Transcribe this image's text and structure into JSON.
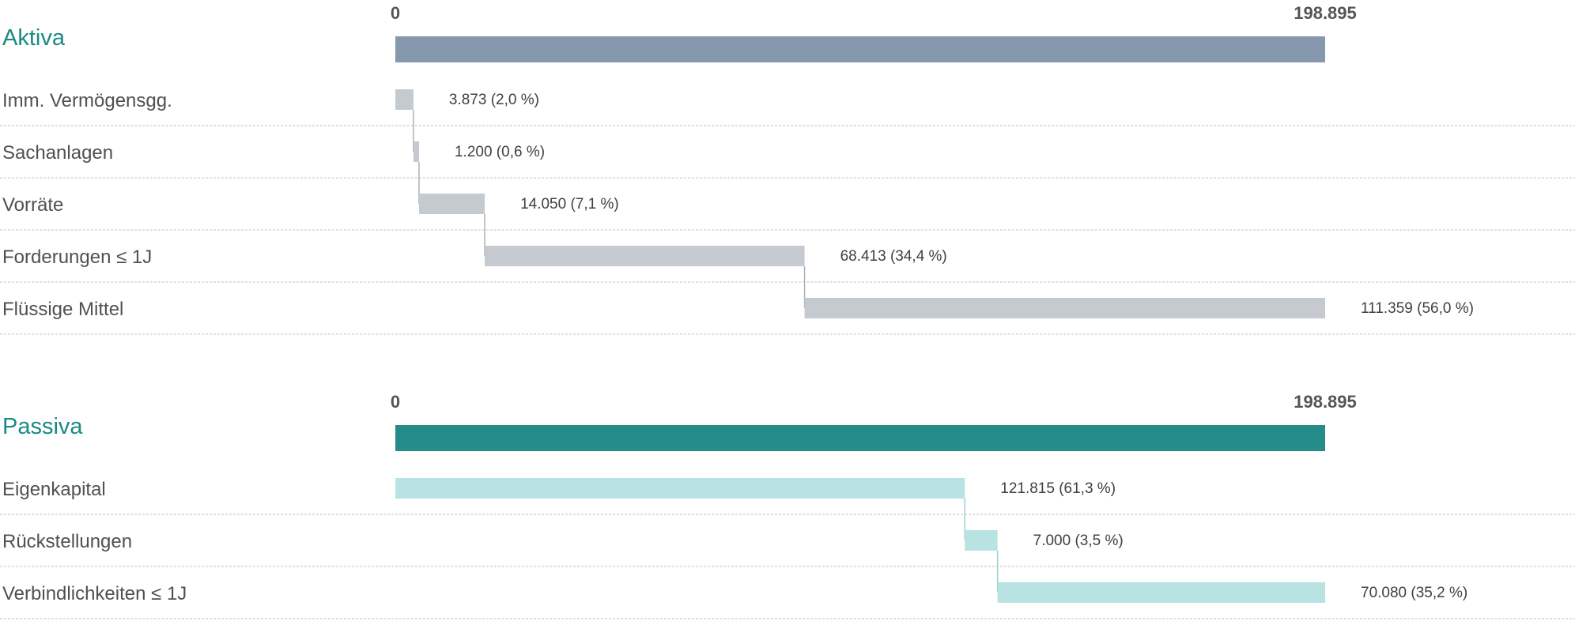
{
  "chart_data": [
    {
      "type": "bar",
      "title": "Aktiva",
      "axis_min_label": "0",
      "axis_max_label": "198.895",
      "xlim": [
        0,
        198895
      ],
      "total": 198895,
      "colors": {
        "title": "#1a8a83",
        "total_bar": "#8598ad",
        "item_bar": "#c5cad0",
        "connector": "#a9b1ba"
      },
      "categories": [
        "Imm. Vermögensgg.",
        "Sachanlagen",
        "Vorräte",
        "Forderungen ≤ 1J",
        "Flüssige Mittel"
      ],
      "values": [
        3873,
        1200,
        14050,
        68413,
        111359
      ],
      "value_labels": [
        "3.873 (2,0 %)",
        "1.200 (0,6 %)",
        "14.050 (7,1 %)",
        "68.413 (34,4 %)",
        "111.359 (56,0 %)"
      ]
    },
    {
      "type": "bar",
      "title": "Passiva",
      "axis_min_label": "0",
      "axis_max_label": "198.895",
      "xlim": [
        0,
        198895
      ],
      "total": 198895,
      "colors": {
        "title": "#1a8a83",
        "total_bar": "#258c89",
        "item_bar": "#b8e3e2",
        "connector": "#9ccfcd"
      },
      "categories": [
        "Eigenkapital",
        "Rückstellungen",
        "Verbindlichkeiten ≤ 1J"
      ],
      "values": [
        121815,
        7000,
        70080
      ],
      "value_labels": [
        "121.815 (61,3 %)",
        "7.000 (3,5 %)",
        "70.080 (35,2 %)"
      ]
    }
  ]
}
